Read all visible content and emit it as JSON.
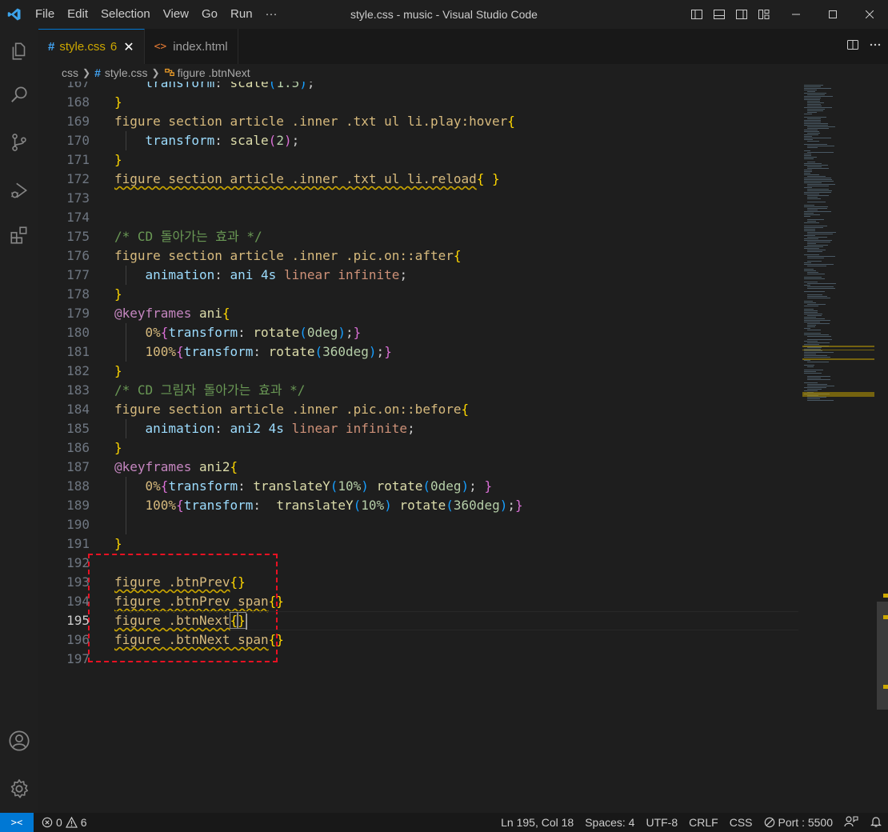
{
  "window": {
    "title": "style.css - music - Visual Studio Code",
    "menu": [
      "File",
      "Edit",
      "Selection",
      "View",
      "Go",
      "Run",
      "···"
    ]
  },
  "tabs": [
    {
      "icon": "#",
      "label": "style.css",
      "badge": "6",
      "close": "✕",
      "active": true
    },
    {
      "icon": "<>",
      "label": "index.html",
      "active": false
    }
  ],
  "breadcrumb": {
    "folder": "css",
    "file_icon": "#",
    "file": "style.css",
    "symbol": "figure .btnNext"
  },
  "editor": {
    "current_line": 195,
    "lines": [
      {
        "n": "167",
        "tokens": [
          {
            "t": "    "
          },
          {
            "t": "transform",
            "c": "prop"
          },
          {
            "t": ": ",
            "c": "punc"
          },
          {
            "t": "scale",
            "c": "fn"
          },
          {
            "t": "(",
            "c": "brace3"
          },
          {
            "t": "1.5",
            "c": "num"
          },
          {
            "t": ")",
            "c": "brace3"
          },
          {
            "t": ";",
            "c": "punc"
          }
        ]
      },
      {
        "n": "168",
        "tokens": [
          {
            "t": "}",
            "c": "brace1"
          }
        ]
      },
      {
        "n": "169",
        "tokens": [
          {
            "t": "figure section article .inner .txt ul li.play:hover",
            "c": "sel"
          },
          {
            "t": "{",
            "c": "brace1"
          }
        ]
      },
      {
        "n": "170",
        "guide": true,
        "tokens": [
          {
            "t": "    "
          },
          {
            "t": "transform",
            "c": "prop"
          },
          {
            "t": ": ",
            "c": "punc"
          },
          {
            "t": "scale",
            "c": "fn"
          },
          {
            "t": "(",
            "c": "brace2"
          },
          {
            "t": "2",
            "c": "num"
          },
          {
            "t": ")",
            "c": "brace2"
          },
          {
            "t": ";",
            "c": "punc"
          }
        ]
      },
      {
        "n": "171",
        "tokens": [
          {
            "t": "}",
            "c": "brace1"
          }
        ]
      },
      {
        "n": "172",
        "tokens": [
          {
            "t": "figure section article .inner .txt ul li.reload",
            "c": "sel-w"
          },
          {
            "t": "{ }",
            "c": "brace1"
          }
        ]
      },
      {
        "n": "173",
        "tokens": []
      },
      {
        "n": "174",
        "tokens": []
      },
      {
        "n": "175",
        "tokens": [
          {
            "t": "/* CD 돌아가는 효과 */",
            "c": "cmt"
          }
        ]
      },
      {
        "n": "176",
        "tokens": [
          {
            "t": "figure section article .inner .pic.on::after",
            "c": "sel"
          },
          {
            "t": "{",
            "c": "brace1"
          }
        ]
      },
      {
        "n": "177",
        "guide": true,
        "tokens": [
          {
            "t": "    "
          },
          {
            "t": "animation",
            "c": "prop"
          },
          {
            "t": ": ",
            "c": "punc"
          },
          {
            "t": "ani 4s ",
            "c": "prop"
          },
          {
            "t": "linear infinite",
            "c": "kw"
          },
          {
            "t": ";",
            "c": "punc"
          }
        ]
      },
      {
        "n": "178",
        "tokens": [
          {
            "t": "}",
            "c": "brace1"
          }
        ]
      },
      {
        "n": "179",
        "tokens": [
          {
            "t": "@keyframes",
            "c": "at"
          },
          {
            "t": " ani",
            "c": "fn"
          },
          {
            "t": "{",
            "c": "brace1"
          }
        ]
      },
      {
        "n": "180",
        "guide": true,
        "tokens": [
          {
            "t": "    "
          },
          {
            "t": "0%",
            "c": "sel"
          },
          {
            "t": "{",
            "c": "brace2"
          },
          {
            "t": "transform",
            "c": "prop"
          },
          {
            "t": ": ",
            "c": "punc"
          },
          {
            "t": "rotate",
            "c": "fn"
          },
          {
            "t": "(",
            "c": "brace3"
          },
          {
            "t": "0deg",
            "c": "num"
          },
          {
            "t": ")",
            "c": "brace3"
          },
          {
            "t": ";",
            "c": "punc"
          },
          {
            "t": "}",
            "c": "brace2"
          }
        ]
      },
      {
        "n": "181",
        "guide": true,
        "tokens": [
          {
            "t": "    "
          },
          {
            "t": "100%",
            "c": "sel"
          },
          {
            "t": "{",
            "c": "brace2"
          },
          {
            "t": "transform",
            "c": "prop"
          },
          {
            "t": ": ",
            "c": "punc"
          },
          {
            "t": "rotate",
            "c": "fn"
          },
          {
            "t": "(",
            "c": "brace3"
          },
          {
            "t": "360deg",
            "c": "num"
          },
          {
            "t": ")",
            "c": "brace3"
          },
          {
            "t": ";",
            "c": "punc"
          },
          {
            "t": "}",
            "c": "brace2"
          }
        ]
      },
      {
        "n": "182",
        "tokens": [
          {
            "t": "}",
            "c": "brace1"
          }
        ]
      },
      {
        "n": "183",
        "tokens": [
          {
            "t": "/* CD 그림자 돌아가는 효과 */",
            "c": "cmt"
          }
        ]
      },
      {
        "n": "184",
        "tokens": [
          {
            "t": "figure section article .inner .pic.on::before",
            "c": "sel"
          },
          {
            "t": "{",
            "c": "brace1"
          }
        ]
      },
      {
        "n": "185",
        "guide": true,
        "tokens": [
          {
            "t": "    "
          },
          {
            "t": "animation",
            "c": "prop"
          },
          {
            "t": ": ",
            "c": "punc"
          },
          {
            "t": "ani2 4s ",
            "c": "prop"
          },
          {
            "t": "linear infinite",
            "c": "kw"
          },
          {
            "t": ";",
            "c": "punc"
          }
        ]
      },
      {
        "n": "186",
        "tokens": [
          {
            "t": "}",
            "c": "brace1"
          }
        ]
      },
      {
        "n": "187",
        "tokens": [
          {
            "t": "@keyframes",
            "c": "at"
          },
          {
            "t": " ani2",
            "c": "fn"
          },
          {
            "t": "{",
            "c": "brace1"
          }
        ]
      },
      {
        "n": "188",
        "guide": true,
        "tokens": [
          {
            "t": "    "
          },
          {
            "t": "0%",
            "c": "sel"
          },
          {
            "t": "{",
            "c": "brace2"
          },
          {
            "t": "transform",
            "c": "prop"
          },
          {
            "t": ": ",
            "c": "punc"
          },
          {
            "t": "translateY",
            "c": "fn"
          },
          {
            "t": "(",
            "c": "brace3"
          },
          {
            "t": "10%",
            "c": "num"
          },
          {
            "t": ")",
            "c": "brace3"
          },
          {
            "t": " "
          },
          {
            "t": "rotate",
            "c": "fn"
          },
          {
            "t": "(",
            "c": "brace3"
          },
          {
            "t": "0deg",
            "c": "num"
          },
          {
            "t": ")",
            "c": "brace3"
          },
          {
            "t": "; ",
            "c": "punc"
          },
          {
            "t": "}",
            "c": "brace2"
          }
        ]
      },
      {
        "n": "189",
        "guide": true,
        "tokens": [
          {
            "t": "    "
          },
          {
            "t": "100%",
            "c": "sel"
          },
          {
            "t": "{",
            "c": "brace2"
          },
          {
            "t": "transform",
            "c": "prop"
          },
          {
            "t": ":  ",
            "c": "punc"
          },
          {
            "t": "translateY",
            "c": "fn"
          },
          {
            "t": "(",
            "c": "brace3"
          },
          {
            "t": "10%",
            "c": "num"
          },
          {
            "t": ")",
            "c": "brace3"
          },
          {
            "t": " "
          },
          {
            "t": "rotate",
            "c": "fn"
          },
          {
            "t": "(",
            "c": "brace3"
          },
          {
            "t": "360deg",
            "c": "num"
          },
          {
            "t": ")",
            "c": "brace3"
          },
          {
            "t": ";",
            "c": "punc"
          },
          {
            "t": "}",
            "c": "brace2"
          }
        ]
      },
      {
        "n": "190",
        "guide": true,
        "tokens": []
      },
      {
        "n": "191",
        "tokens": [
          {
            "t": "}",
            "c": "brace1"
          }
        ]
      },
      {
        "n": "192",
        "tokens": []
      },
      {
        "n": "193",
        "tokens": [
          {
            "t": "figure .btnPrev",
            "c": "sel-w"
          },
          {
            "t": "{}",
            "c": "brace1"
          }
        ]
      },
      {
        "n": "194",
        "tokens": [
          {
            "t": "figure .btnPrev span",
            "c": "sel-w"
          },
          {
            "t": "{}",
            "c": "brace1"
          }
        ]
      },
      {
        "n": "195",
        "tokens": [
          {
            "t": "figure .btnNext",
            "c": "sel-w"
          },
          {
            "t": "{}",
            "c": "brace1",
            "match": true
          }
        ],
        "cursor": true
      },
      {
        "n": "196",
        "tokens": [
          {
            "t": "figure .btnNext span",
            "c": "sel-w"
          },
          {
            "t": "{}",
            "c": "brace1"
          }
        ]
      },
      {
        "n": "197",
        "tokens": []
      }
    ]
  },
  "statusbar": {
    "remote_icon": "><",
    "errors": "0",
    "warnings": "6",
    "position": "Ln 195, Col 18",
    "spaces": "Spaces: 4",
    "encoding": "UTF-8",
    "eol": "CRLF",
    "language": "CSS",
    "port": "Port : 5500"
  },
  "colors": {
    "accent": "#0078d4",
    "warning": "#cca700",
    "highlight_box": "#e81123"
  }
}
